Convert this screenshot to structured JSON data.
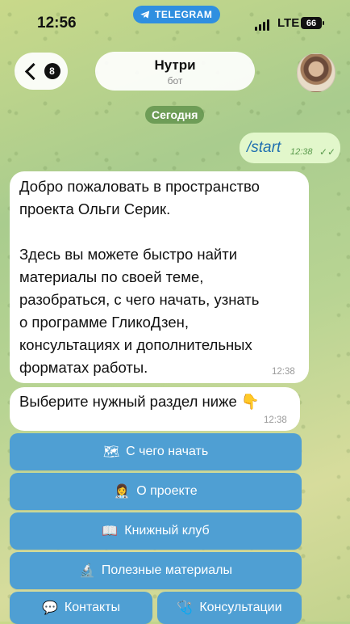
{
  "status_bar": {
    "time": "12:56",
    "app_badge": "TELEGRAM",
    "network": "LTE",
    "battery": "66"
  },
  "header": {
    "unread_count": "8",
    "chat_title": "Нутри",
    "chat_subtitle": "бот"
  },
  "date_separator": "Сегодня",
  "messages": [
    {
      "direction": "out",
      "text": "/start",
      "time": "12:38"
    },
    {
      "direction": "in",
      "line1": "Добро пожаловать в пространство",
      "line2": "проекта Ольги Серик.",
      "line3": "Здесь вы можете быстро найти",
      "line4": "материалы по своей теме,",
      "line5": "разобраться, с чего начать, узнать",
      "line6": "о программе ГликоДзен,",
      "line7": "консультациях и дополнительных",
      "line8": "форматах работы.",
      "time": "12:38"
    },
    {
      "direction": "in",
      "text": "Выберите нужный раздел ниже 👇",
      "time": "12:38"
    }
  ],
  "keyboard": {
    "start": {
      "icon": "🗺",
      "label": "С чего начать"
    },
    "about": {
      "icon": "👩‍⚕️",
      "label": "О проекте"
    },
    "book_club": {
      "icon": "📖",
      "label": "Книжный клуб"
    },
    "materials": {
      "icon": "🔬",
      "label": "Полезные материалы"
    },
    "contacts": {
      "icon": "💬",
      "label": "Контакты"
    },
    "consultations": {
      "icon": "🩺",
      "label": "Консультации"
    }
  },
  "colors": {
    "keyboard_button": "#4f9fd3",
    "outgoing_bubble": "#e2f7cb",
    "incoming_bubble": "#ffffff"
  }
}
